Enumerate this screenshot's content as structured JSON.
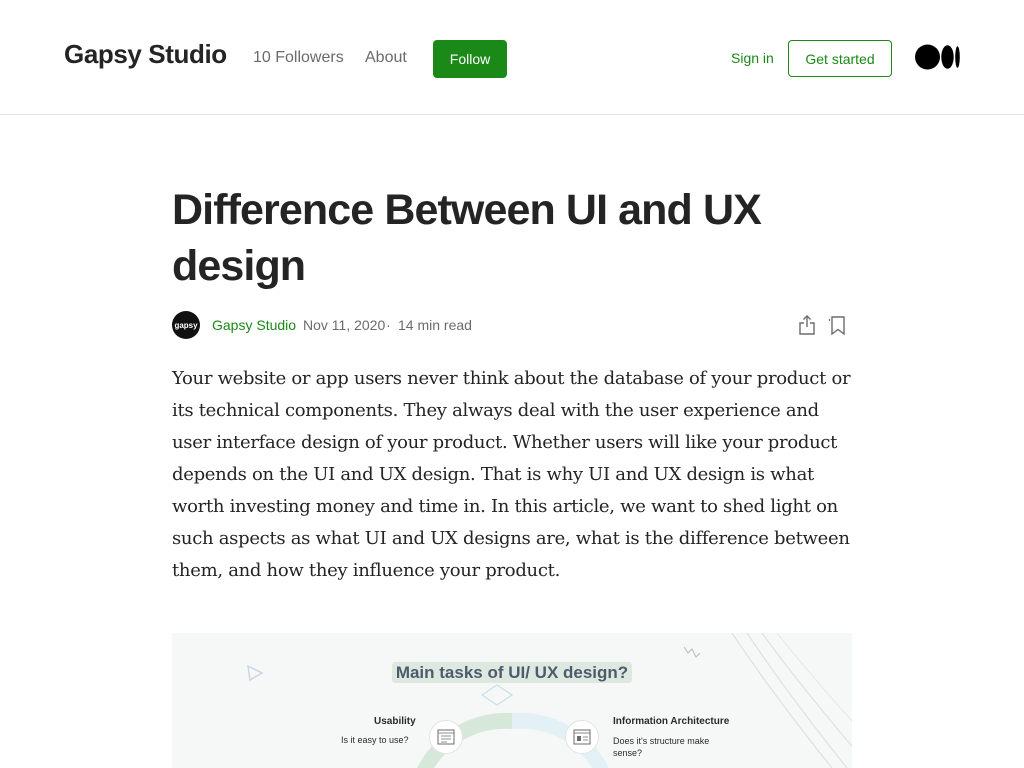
{
  "header": {
    "publication_name": "Gapsy Studio",
    "followers": "10 Followers",
    "about": "About",
    "follow_label": "Follow",
    "sign_in": "Sign in",
    "get_started": "Get started",
    "logo_icon": "medium-logo-icon"
  },
  "article": {
    "title": "Difference Between UI and UX design",
    "author": {
      "avatar_text": "gapsy",
      "name": "Gapsy Studio",
      "date": "Nov 11, 2020",
      "separator": "·",
      "read_time": "14 min read"
    },
    "actions": {
      "share_icon": "share-icon",
      "bookmark_icon": "bookmark-icon"
    },
    "intro": "Your website or app users never think about the database of your product or its technical components. They always deal with the user experience and user interface design of your product. Whether users will like your product depends on the UI and UX design. That is why UI and UX design is what worth investing money and time in. In this article, we want to shed light on such aspects as what UI and UX designs are, what is the difference between them, and how they influence your product.",
    "hero_image": {
      "heading": "Main tasks of UI/ UX design?",
      "left_title": "Usability",
      "left_subtitle": "Is it easy to use?",
      "right_title": "Information Architecture",
      "right_subtitle": "Does it's structure make sense?",
      "accent_green": "#dde9e0",
      "accent_blue": "#e3f1f7"
    }
  },
  "colors": {
    "brand_green": "#1a8917",
    "text_primary": "#242424",
    "text_secondary": "#6b6b6b"
  }
}
